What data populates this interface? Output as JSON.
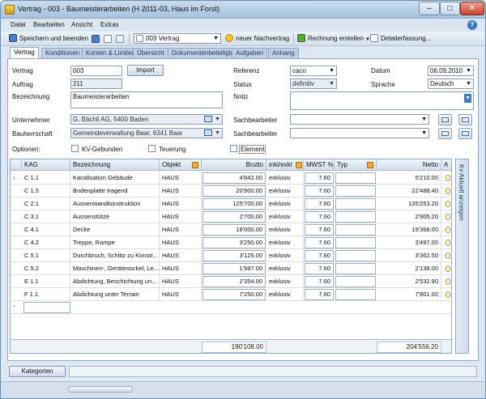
{
  "window": {
    "title": "Vertrag - 003 - Baumeisterarbeiten (H 2011-03, Haus im Forst)",
    "min": "–",
    "max": "□",
    "close": "✕"
  },
  "menu": [
    "Datei",
    "Bearbeiten",
    "Ansicht",
    "Extras"
  ],
  "help": "?",
  "toolbar": {
    "save_close": "Speichern und beenden",
    "vertrag_select": "003 Vertrag",
    "new_nachvertrag": "neuer Nachvertrag",
    "rechnung": "Rechnung erstellen",
    "detailerfassung": "Detailerfassung..."
  },
  "tabs": [
    "Vertrag",
    "Konditionen",
    "Konten & Limiten",
    "Übersicht",
    "Dokumentenbeteiligte",
    "Aufgaben",
    "Anhang"
  ],
  "form": {
    "vertrag_label": "Vertrag",
    "vertrag_value": "003",
    "import_button": "Import",
    "auftrag_label": "Auftrag",
    "auftrag_value": "211",
    "bezeichnung_label": "Bezeichnung",
    "bezeichnung_value": "Baumeisterarbeiten",
    "referenz_label": "Referenz",
    "referenz_value": "caco",
    "status_label": "Status",
    "status_value": "definitiv",
    "notiz_label": "Notiz",
    "datum_label": "Datum",
    "datum_value": "06.09.2010",
    "sprache_label": "Sprache",
    "sprache_value": "Deutsch",
    "unternehmer_label": "Unternehmer",
    "unternehmer_value": "G. Bächli AG, 5400 Baden",
    "bauherrschaft_label": "Bauherrschaft",
    "bauherrschaft_value": "Gemeindeverwaltung Baar, 6341 Baar",
    "sachbearbeiter_label": "Sachbearbeiter",
    "optionen_label": "Optionen:",
    "opt_kv": "KV-Gebunden",
    "opt_teuerung": "Teuerung",
    "opt_element": "Element"
  },
  "grid": {
    "headers": {
      "kag": "KAG",
      "bezeichnung": "Bezeichnung",
      "objekt": "Objekt",
      "brutto": "Brutto",
      "inkl": "inkl/exkl",
      "mwst": "MWST %",
      "typ": "Typ",
      "netto": "Netto",
      "a": "A"
    },
    "rows": [
      {
        "kag": "C 1.1",
        "bez": "Kanalisation Gebäude",
        "obj": "HAUS",
        "brutto": "4'842.00",
        "inkl": "exklusiv",
        "mwst": "7.60",
        "netto": "5'210.00"
      },
      {
        "kag": "C 1.5",
        "bez": "Bodenplatte tragend",
        "obj": "HAUS",
        "brutto": "20'900.00",
        "inkl": "exklusiv",
        "mwst": "7.60",
        "netto": "22'488.40"
      },
      {
        "kag": "C 2.1",
        "bez": "Aussenwandkonstruktion",
        "obj": "HAUS",
        "brutto": "125'700.00",
        "inkl": "exklusiv",
        "mwst": "7.60",
        "netto": "135'253.20"
      },
      {
        "kag": "C 3.1",
        "bez": "Aussenstütze",
        "obj": "HAUS",
        "brutto": "2'700.00",
        "inkl": "exklusiv",
        "mwst": "7.60",
        "netto": "2'905.20"
      },
      {
        "kag": "C 4.1",
        "bez": "Decke",
        "obj": "HAUS",
        "brutto": "18'000.00",
        "inkl": "exklusiv",
        "mwst": "7.60",
        "netto": "19'368.00"
      },
      {
        "kag": "C 4.2",
        "bez": "Treppe, Rampe",
        "obj": "HAUS",
        "brutto": "3'250.00",
        "inkl": "exklusiv",
        "mwst": "7.60",
        "netto": "3'497.00"
      },
      {
        "kag": "C 5.1",
        "bez": "Durchbruch, Schlitz zu Konstr...",
        "obj": "HAUS",
        "brutto": "3'125.00",
        "inkl": "exklusiv",
        "mwst": "7.60",
        "netto": "3'362.50"
      },
      {
        "kag": "C 5.2",
        "bez": "Maschinen-, Gerätesockel, Le...",
        "obj": "HAUS",
        "brutto": "1'987.00",
        "inkl": "exklusiv",
        "mwst": "7.60",
        "netto": "2'138.00"
      },
      {
        "kag": "E 1.1",
        "bez": "Abdichtung, Beschichtung un...",
        "obj": "HAUS",
        "brutto": "2'354.00",
        "inkl": "exklusiv",
        "mwst": "7.60",
        "netto": "2'532.90"
      },
      {
        "kag": "F 1.1",
        "bez": "Abdichtung unter Terrain",
        "obj": "HAUS",
        "brutto": "7'250.00",
        "inkl": "exklusiv",
        "mwst": "7.60",
        "netto": "7'801.00"
      }
    ],
    "row_indicator": "›",
    "new_row": "*",
    "total_brutto": "190'108.00",
    "total_netto": "204'556.20"
  },
  "sidebar_label": "Kv Aktuell anzeigen",
  "kategorien_button": "Kategorien"
}
